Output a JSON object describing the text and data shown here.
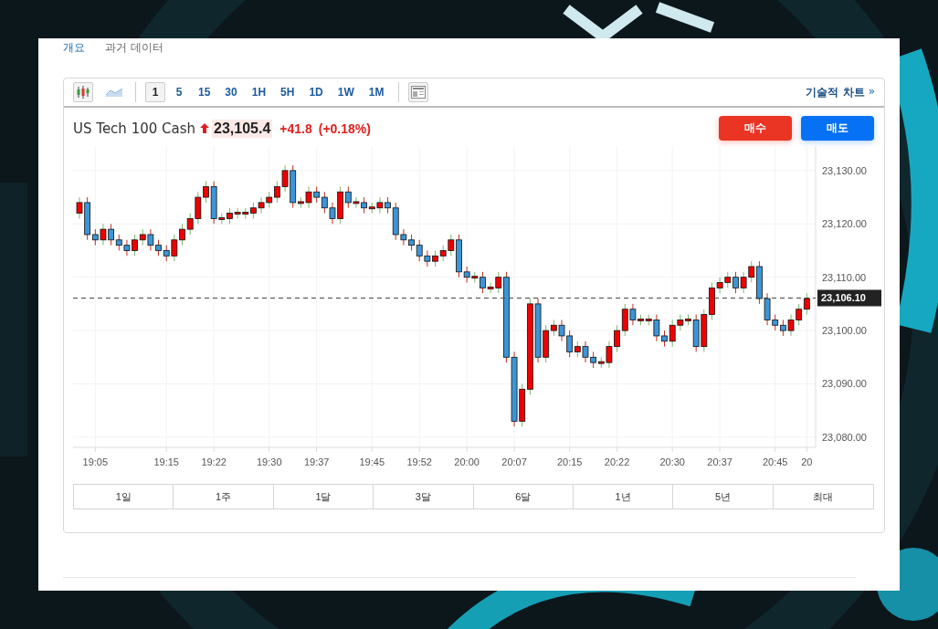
{
  "tabs": [
    {
      "label": "개요",
      "selected": true
    },
    {
      "label": "과거 데이터",
      "selected": false
    }
  ],
  "toolbar": {
    "chart_types": [
      {
        "kind": "candles",
        "selected": true
      },
      {
        "kind": "area",
        "selected": false
      }
    ],
    "intervals": [
      {
        "label": "1",
        "selected": true
      },
      {
        "label": "5",
        "selected": false
      },
      {
        "label": "15",
        "selected": false
      },
      {
        "label": "30",
        "selected": false
      },
      {
        "label": "1H",
        "selected": false
      },
      {
        "label": "5H",
        "selected": false
      },
      {
        "label": "1D",
        "selected": false
      },
      {
        "label": "1W",
        "selected": false
      },
      {
        "label": "1M",
        "selected": false
      }
    ],
    "technical_link": "기술적 차트",
    "technical_arrow": "»"
  },
  "quote": {
    "name": "US Tech 100 Cash",
    "rising": true,
    "price": "23,105.4",
    "change": "+41.8",
    "change_pct": "(+0.18%)"
  },
  "buttons": [
    {
      "label": "매수",
      "kind": "buy"
    },
    {
      "label": "매도",
      "kind": "sell"
    }
  ],
  "chart": {
    "chart_data": {
      "type": "candlestick",
      "categories": [
        null,
        null,
        "19:05",
        null,
        null,
        null,
        null,
        null,
        null,
        null,
        null,
        "19:15",
        null,
        null,
        null,
        null,
        null,
        "19:22",
        null,
        null,
        null,
        null,
        null,
        null,
        "19:30",
        null,
        null,
        null,
        null,
        null,
        "19:37",
        null,
        null,
        null,
        null,
        null,
        null,
        "19:45",
        null,
        null,
        null,
        null,
        null,
        "19:52",
        null,
        null,
        null,
        null,
        null,
        "20:00",
        null,
        null,
        null,
        null,
        null,
        "20:07",
        null,
        null,
        null,
        null,
        null,
        null,
        "20:15",
        null,
        null,
        null,
        null,
        null,
        "20:22",
        null,
        null,
        null,
        null,
        null,
        null,
        "20:30",
        null,
        null,
        null,
        null,
        null,
        "20:37",
        null,
        null,
        null,
        null,
        null,
        null,
        "20:45",
        null,
        null,
        null,
        "20"
      ],
      "ohlc": [
        [
          23122,
          23125,
          23121,
          23124
        ],
        [
          23124,
          23125,
          23117,
          23118
        ],
        [
          23118,
          23119,
          23116,
          23117
        ],
        [
          23117,
          23120,
          23116,
          23119
        ],
        [
          23119,
          23120,
          23116,
          23117
        ],
        [
          23117,
          23118,
          23115,
          23116
        ],
        [
          23116,
          23117,
          23114,
          23115
        ],
        [
          23115,
          23118,
          23114,
          23117
        ],
        [
          23117,
          23119,
          23116,
          23118
        ],
        [
          23118,
          23119,
          23115,
          23116
        ],
        [
          23116,
          23117,
          23114,
          23115
        ],
        [
          23115,
          23116,
          23113,
          23114
        ],
        [
          23114,
          23118,
          23113,
          23117
        ],
        [
          23117,
          23120,
          23116,
          23119
        ],
        [
          23119,
          23122,
          23118,
          23121
        ],
        [
          23121,
          23126,
          23120,
          23125
        ],
        [
          23125,
          23128,
          23124,
          23127
        ],
        [
          23127,
          23128,
          23120,
          23121
        ],
        [
          23121,
          23122,
          23120,
          23121
        ],
        [
          23121,
          23123,
          23120,
          23122
        ],
        [
          23122,
          23123,
          23121,
          23122
        ],
        [
          23122,
          23123,
          23121,
          23122
        ],
        [
          23122,
          23124,
          23121,
          23123
        ],
        [
          23123,
          23125,
          23122,
          23124
        ],
        [
          23124,
          23126,
          23123,
          23125
        ],
        [
          23125,
          23128,
          23124,
          23127
        ],
        [
          23127,
          23131,
          23126,
          23130
        ],
        [
          23130,
          23131,
          23123,
          23124
        ],
        [
          23124,
          23125,
          23123,
          23124
        ],
        [
          23124,
          23127,
          23123,
          23126
        ],
        [
          23126,
          23127,
          23124,
          23125
        ],
        [
          23125,
          23126,
          23122,
          23123
        ],
        [
          23123,
          23124,
          23120,
          23121
        ],
        [
          23121,
          23127,
          23120,
          23126
        ],
        [
          23126,
          23127,
          23123,
          23124
        ],
        [
          23124,
          23125,
          23123,
          23124
        ],
        [
          23124,
          23125,
          23122,
          23123
        ],
        [
          23123,
          23124,
          23122,
          23123
        ],
        [
          23123,
          23125,
          23122,
          23124
        ],
        [
          23124,
          23125,
          23122,
          23123
        ],
        [
          23123,
          23124,
          23117,
          23118
        ],
        [
          23118,
          23119,
          23116,
          23117
        ],
        [
          23117,
          23118,
          23115,
          23116
        ],
        [
          23116,
          23117,
          23113,
          23114
        ],
        [
          23114,
          23115,
          23112,
          23113
        ],
        [
          23113,
          23115,
          23112,
          23114
        ],
        [
          23114,
          23116,
          23113,
          23115
        ],
        [
          23115,
          23118,
          23114,
          23117
        ],
        [
          23117,
          23118,
          23110,
          23111
        ],
        [
          23111,
          23112,
          23109,
          23110
        ],
        [
          23110,
          23111,
          23109,
          23110
        ],
        [
          23110,
          23111,
          23107,
          23108
        ],
        [
          23108,
          23109,
          23107,
          23108
        ],
        [
          23108,
          23111,
          23107,
          23110
        ],
        [
          23110,
          23111,
          23094,
          23095
        ],
        [
          23095,
          23096,
          23082,
          23083
        ],
        [
          23083,
          23090,
          23082,
          23089
        ],
        [
          23089,
          23106,
          23088,
          23105
        ],
        [
          23105,
          23106,
          23094,
          23095
        ],
        [
          23095,
          23101,
          23094,
          23100
        ],
        [
          23100,
          23102,
          23099,
          23101
        ],
        [
          23101,
          23102,
          23098,
          23099
        ],
        [
          23099,
          23100,
          23095,
          23096
        ],
        [
          23096,
          23098,
          23095,
          23097
        ],
        [
          23097,
          23098,
          23094,
          23095
        ],
        [
          23095,
          23096,
          23093,
          23094
        ],
        [
          23094,
          23095,
          23093,
          23094
        ],
        [
          23094,
          23098,
          23093,
          23097
        ],
        [
          23097,
          23101,
          23096,
          23100
        ],
        [
          23100,
          23105,
          23099,
          23104
        ],
        [
          23104,
          23105,
          23101,
          23102
        ],
        [
          23102,
          23103,
          23101,
          23102
        ],
        [
          23102,
          23103,
          23101,
          23102
        ],
        [
          23102,
          23103,
          23098,
          23099
        ],
        [
          23099,
          23100,
          23097,
          23098
        ],
        [
          23098,
          23102,
          23097,
          23101
        ],
        [
          23101,
          23103,
          23100,
          23102
        ],
        [
          23102,
          23103,
          23101,
          23102
        ],
        [
          23102,
          23103,
          23096,
          23097
        ],
        [
          23097,
          23104,
          23096,
          23103
        ],
        [
          23103,
          23109,
          23102,
          23108
        ],
        [
          23108,
          23110,
          23107,
          23109
        ],
        [
          23109,
          23111,
          23108,
          23110
        ],
        [
          23110,
          23111,
          23107,
          23108
        ],
        [
          23108,
          23111,
          23107,
          23110
        ],
        [
          23110,
          23113,
          23109,
          23112
        ],
        [
          23112,
          23113,
          23105,
          23106
        ],
        [
          23106,
          23107,
          23101,
          23102
        ],
        [
          23102,
          23103,
          23100,
          23101
        ],
        [
          23101,
          23102,
          23099,
          23100
        ],
        [
          23100,
          23103,
          23099,
          23102
        ],
        [
          23102,
          23105,
          23101,
          23104
        ],
        [
          23104,
          23107,
          23103,
          23106
        ]
      ],
      "yticks": [
        {
          "value": 23130,
          "label": "23,130.00"
        },
        {
          "value": 23120,
          "label": "23,120.00"
        },
        {
          "value": 23110,
          "label": "23,110.00"
        },
        {
          "value": 23100,
          "label": "23,100.00"
        },
        {
          "value": 23090,
          "label": "23,090.00"
        },
        {
          "value": 23080,
          "label": "23,080.00"
        }
      ],
      "ylim": [
        23078.1,
        23134.6
      ],
      "grid": true,
      "ref_lines": [
        {
          "axis": "y",
          "value": 23106.1
        }
      ]
    },
    "last_price": "23,106.10"
  },
  "ranges": [
    {
      "label": "1일"
    },
    {
      "label": "1주"
    },
    {
      "label": "1달"
    },
    {
      "label": "3달"
    },
    {
      "label": "6달"
    },
    {
      "label": "1년"
    },
    {
      "label": "5년"
    },
    {
      "label": "최대"
    }
  ]
}
